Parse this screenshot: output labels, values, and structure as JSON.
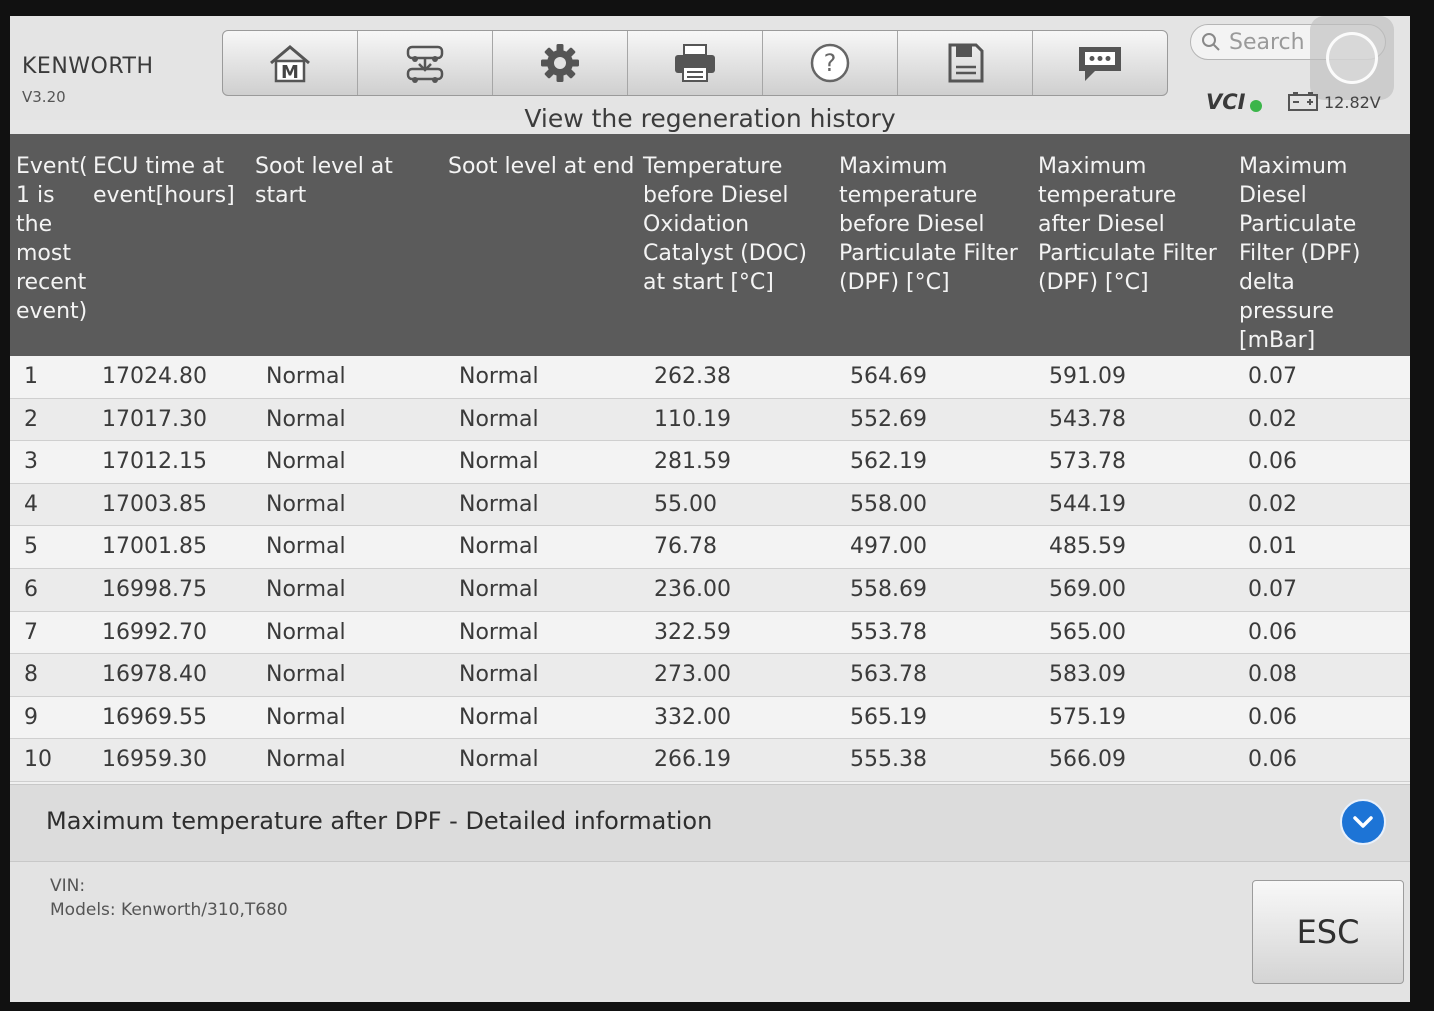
{
  "app": {
    "brand": "KENWORTH",
    "version": "V3.20"
  },
  "toolbar": {
    "buttons": [
      {
        "icon": "home-m-icon"
      },
      {
        "icon": "vehicle-swap-icon"
      },
      {
        "icon": "gear-icon"
      },
      {
        "icon": "printer-icon"
      },
      {
        "icon": "help-icon"
      },
      {
        "icon": "save-icon"
      },
      {
        "icon": "chat-icon"
      }
    ]
  },
  "search": {
    "placeholder": "Search"
  },
  "status": {
    "vci_label": "VCI",
    "voltage": "12.82V"
  },
  "page_title": "View the regeneration history",
  "table": {
    "headers": [
      "Event(\n1 is\nthe\nmost\nrecent\nevent)",
      "ECU time at\nevent[hours]",
      "Soot level at\nstart",
      "Soot level at end",
      "Temperature\nbefore Diesel\nOxidation\nCatalyst (DOC)\nat start [°C]",
      "Maximum\ntemperature\nbefore Diesel\nParticulate Filter\n(DPF) [°C]",
      "Maximum\ntemperature\nafter Diesel\nParticulate Filter\n(DPF) [°C]",
      "Maximum\nDiesel\nParticulate\nFilter (DPF)\ndelta\npressure\n[mBar]"
    ],
    "rows": [
      [
        "1",
        "17024.80",
        "Normal",
        "Normal",
        "262.38",
        "564.69",
        "591.09",
        "0.07"
      ],
      [
        "2",
        "17017.30",
        "Normal",
        "Normal",
        "110.19",
        "552.69",
        "543.78",
        "0.02"
      ],
      [
        "3",
        "17012.15",
        "Normal",
        "Normal",
        "281.59",
        "562.19",
        "573.78",
        "0.06"
      ],
      [
        "4",
        "17003.85",
        "Normal",
        "Normal",
        "55.00",
        "558.00",
        "544.19",
        "0.02"
      ],
      [
        "5",
        "17001.85",
        "Normal",
        "Normal",
        "76.78",
        "497.00",
        "485.59",
        "0.01"
      ],
      [
        "6",
        "16998.75",
        "Normal",
        "Normal",
        "236.00",
        "558.69",
        "569.00",
        "0.07"
      ],
      [
        "7",
        "16992.70",
        "Normal",
        "Normal",
        "322.59",
        "553.78",
        "565.00",
        "0.06"
      ],
      [
        "8",
        "16978.40",
        "Normal",
        "Normal",
        "273.00",
        "563.78",
        "583.09",
        "0.08"
      ],
      [
        "9",
        "16969.55",
        "Normal",
        "Normal",
        "332.00",
        "565.19",
        "575.19",
        "0.06"
      ],
      [
        "10",
        "16959.30",
        "Normal",
        "Normal",
        "266.19",
        "555.38",
        "566.09",
        "0.06"
      ]
    ]
  },
  "detail": {
    "text": "Maximum temperature after DPF - Detailed information"
  },
  "footer": {
    "vin_label": "VIN:",
    "models": "Models: Kenworth/310,T680",
    "esc_label": "ESC"
  },
  "colors": {
    "header_bg": "#5b5b5b",
    "accent_blue": "#1d74d6",
    "vci_ok": "#3bb54a"
  }
}
